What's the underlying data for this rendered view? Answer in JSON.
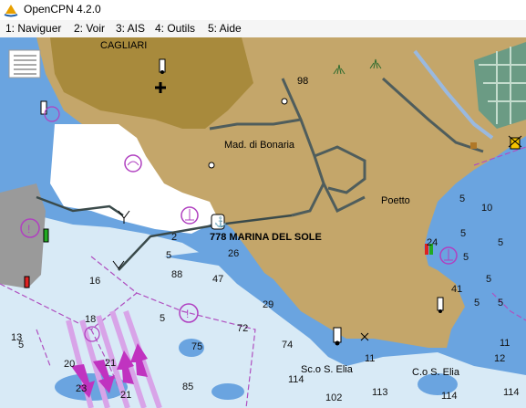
{
  "window": {
    "title": "OpenCPN 4.2.0",
    "icon": "opencpn-app-icon"
  },
  "menu": {
    "items": [
      "1: Naviguer",
      "2: Voir",
      "3: AIS",
      "4: Outils",
      "5: Aide"
    ]
  },
  "colors": {
    "land": "#c4a66a",
    "urban": "#a88a3c",
    "shallow_water": "#6aa4e0",
    "deep_water": "#d8eaf6",
    "harbour": "#ffffff",
    "green_area": "#6b9b84",
    "sea_lane": "#c07ad8",
    "traffic_arrow": "#c033c0",
    "road": "#4f5d5c",
    "route": "#3a4a4a"
  },
  "chart": {
    "place_labels": {
      "cagliari": "CAGLIARI",
      "bonaria": "Mad. di Bonaria",
      "poetto": "Poetto",
      "marina": "778 MARINA DEL SOLE",
      "sc_elia": "Sc.o S. Elia",
      "c_elia": "C.o S. Elia",
      "spot_98": "98"
    },
    "soundings": [
      "5",
      "10",
      "5",
      "5",
      "5",
      "24",
      "5",
      "41",
      "5",
      "5",
      "2",
      "26",
      "5",
      "47",
      "88",
      "29",
      "74",
      "72",
      "16",
      "18",
      "20",
      "21",
      "23",
      "21",
      "5",
      "13",
      "5",
      "75",
      "85",
      "114",
      "102",
      "113",
      "114",
      "114",
      "11",
      "12",
      "11"
    ]
  },
  "icons": {
    "chart_menu": "chart-options-icon",
    "lighthouse": "lighthouse-icon",
    "buoy": "buoy-icon",
    "anchorage": "anchor-icon",
    "caution": "caution-icon",
    "harbour": "harbour-icon",
    "light": "light-icon"
  }
}
